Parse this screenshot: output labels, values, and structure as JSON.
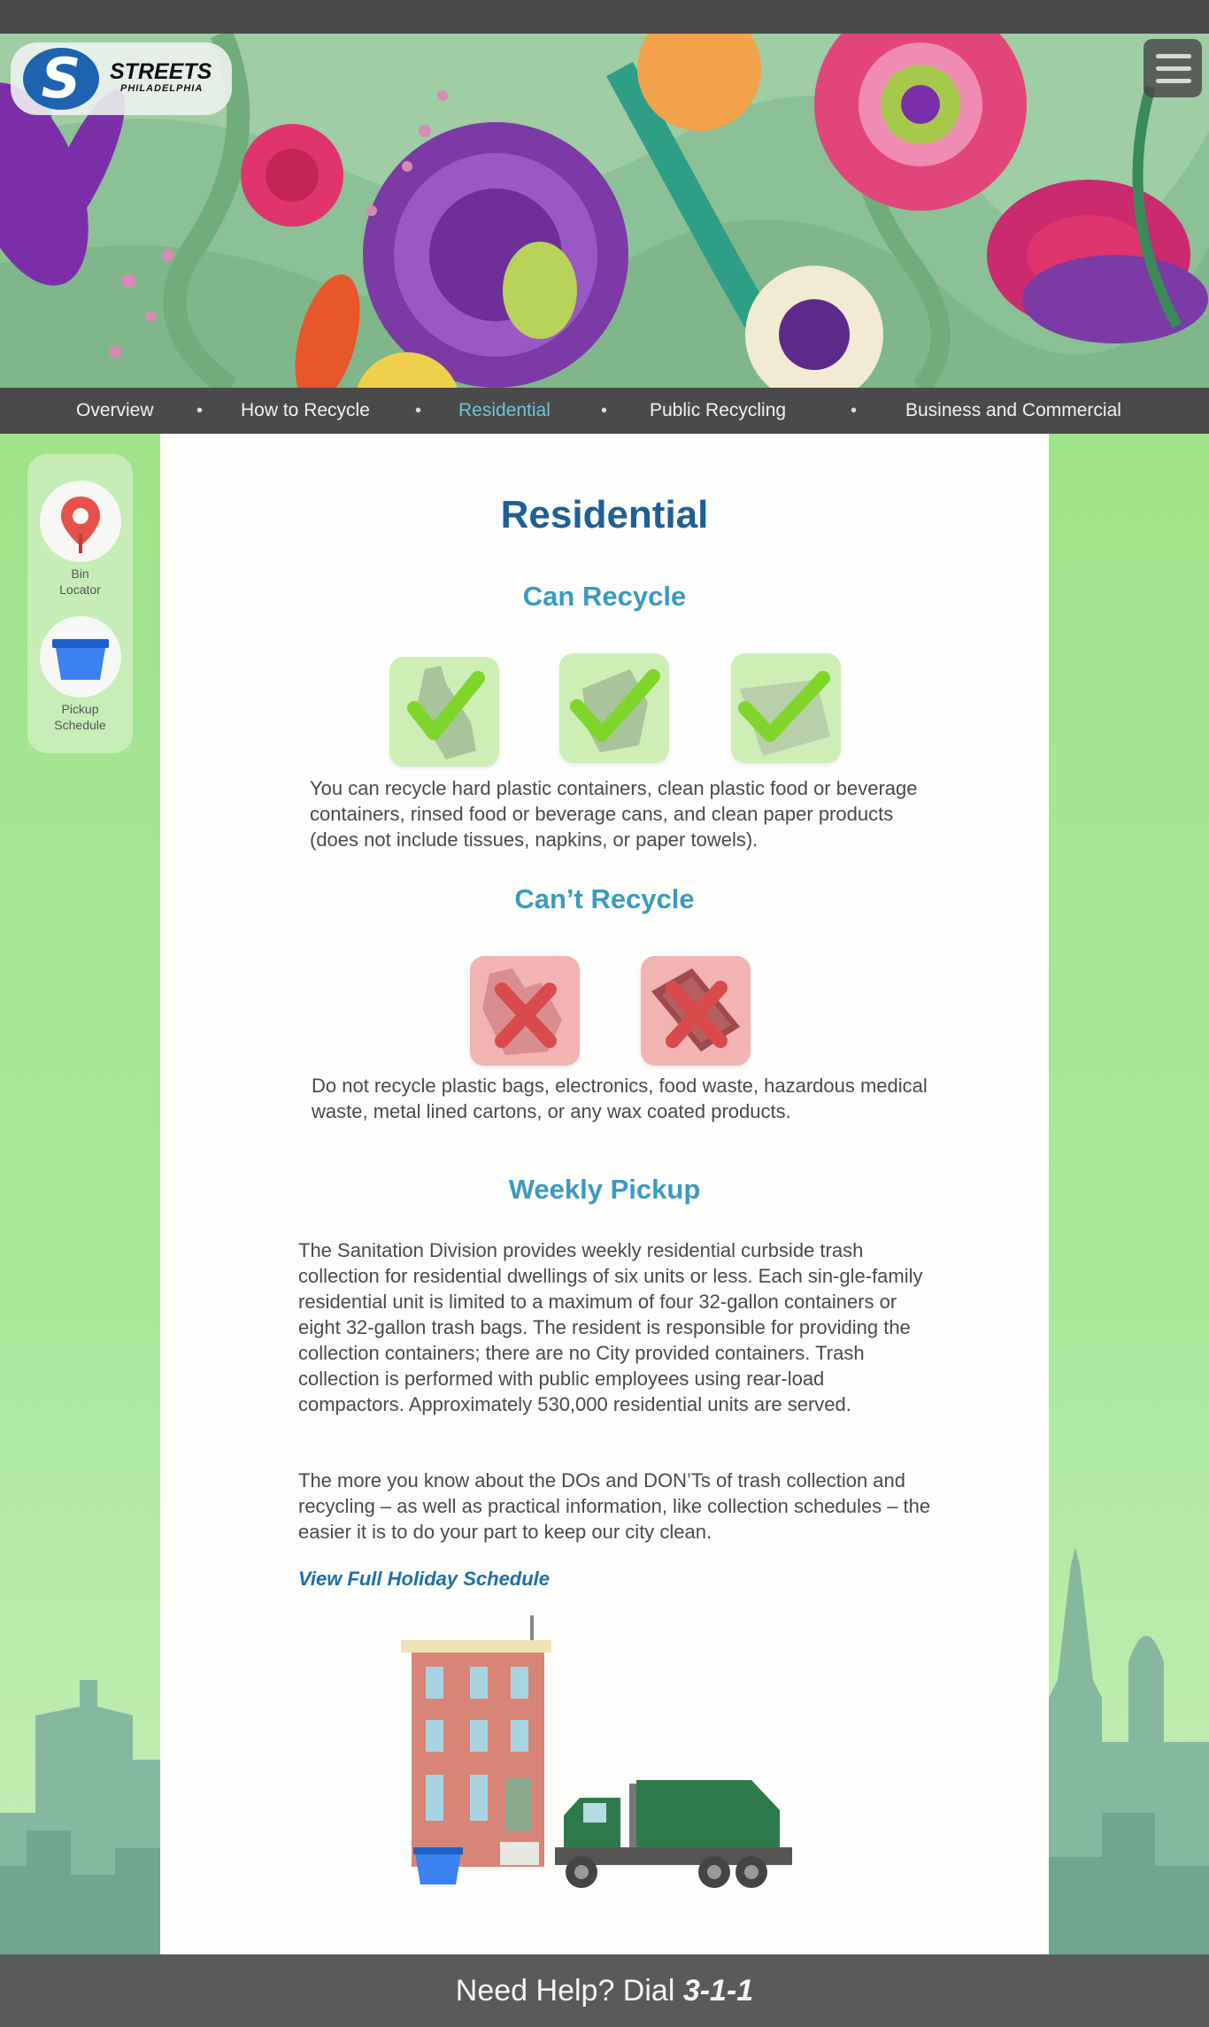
{
  "brand": {
    "name": "STREETS",
    "sub": "PHILADELPHIA",
    "logo_letter": "S"
  },
  "header": {
    "menu_icon": "hamburger-icon"
  },
  "nav": {
    "items": [
      {
        "label": "Overview",
        "active": false
      },
      {
        "label": "How to Recycle",
        "active": false
      },
      {
        "label": "Residential",
        "active": true
      },
      {
        "label": "Public Recycling",
        "active": false
      },
      {
        "label": "Business and Commercial",
        "active": false
      }
    ],
    "separator": "•"
  },
  "tools": [
    {
      "label": "Bin\nLocator",
      "icon": "map-pin-icon"
    },
    {
      "label": "Pickup\nSchedule",
      "icon": "recycling-bin-icon"
    }
  ],
  "main": {
    "title": "Residential",
    "can_recycle": {
      "heading": "Can Recycle",
      "icons": [
        "plastic-bottle-icon",
        "can-icon",
        "paper-icon"
      ],
      "text": "You can recycle hard plastic containers, clean plastic food or beverage containers, rinsed food or beverage cans, and clean paper products (does not include tissues, napkins, or paper towels)."
    },
    "cant_recycle": {
      "heading": "Can’t Recycle",
      "icons": [
        "plastic-bag-icon",
        "electronics-icon"
      ],
      "text": "Do not recycle plastic bags, electronics, food waste, hazardous medical waste, metal lined cartons, or any wax coated products."
    },
    "weekly_pickup": {
      "heading": "Weekly Pickup",
      "p1": "The Sanitation Division provides weekly residential curbside trash collection for residential dwellings of six units or less. Each sin-gle-family residential unit is limited to a maximum of four 32-gallon containers or eight 32-gallon trash bags. The resident is responsible for providing the collection containers; there are no City provided containers. Trash collection is performed with public employees using rear-load compactors. Approximately 530,000 residential units are served.",
      "p2": "The more you know about the DOs and DON’Ts of trash collection and recycling – as well as practical information, like collection schedules – the easier it is to do your part to keep our city clean.",
      "link": "View Full Holiday Schedule"
    }
  },
  "footer": {
    "prefix": "Need Help?  Dial ",
    "number": "3-1-1"
  },
  "colors": {
    "nav_bg": "#4a4a4a",
    "active_nav": "#6ec6d8",
    "title": "#1f5f95",
    "heading": "#3a9ac2",
    "side_green": "#9fe38a"
  }
}
